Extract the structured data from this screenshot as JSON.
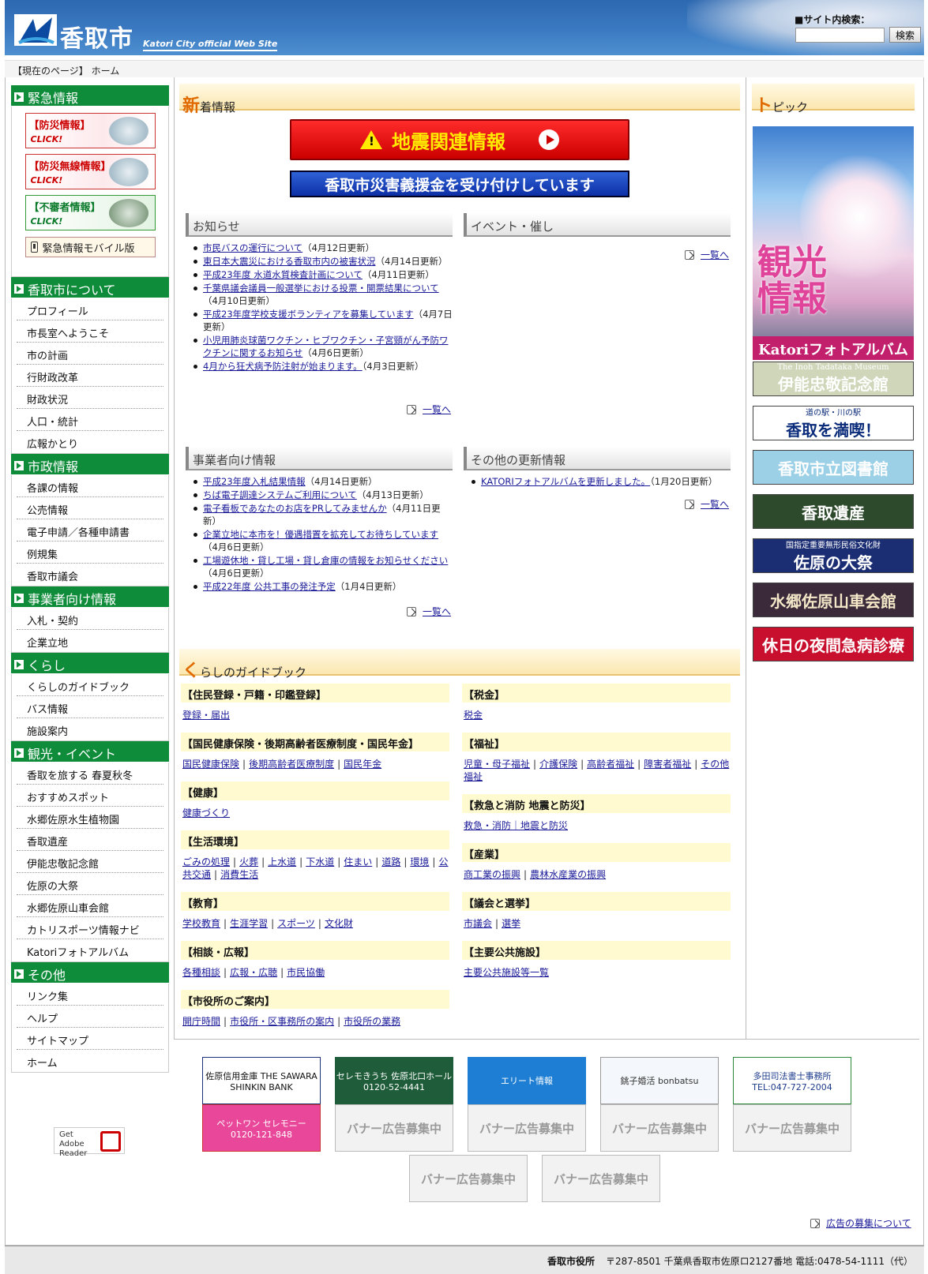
{
  "header": {
    "title": "香取市",
    "subtitle": "Katori City official Web Site",
    "search_label": "■サイト内検索：",
    "search_value": "",
    "search_button": "検索"
  },
  "breadcrumb": {
    "label": "【現在のページ】",
    "current": "ホーム"
  },
  "left_nav": {
    "emergency": {
      "title": "緊急情報",
      "banners": [
        {
          "label": "【防災情報】",
          "click": "CLICK!"
        },
        {
          "label": "【防災無線情報】",
          "click": "CLICK!"
        },
        {
          "label": "【不審者情報】",
          "click": "CLICK!"
        }
      ],
      "mobile": "緊急情報モバイル版"
    },
    "sections": [
      {
        "title": "香取市について",
        "items": [
          "プロフィール",
          "市長室へようこそ",
          "市の計画",
          "行財政改革",
          "財政状況",
          "人口・統計",
          "広報かとり"
        ]
      },
      {
        "title": "市政情報",
        "items": [
          "各課の情報",
          "公売情報",
          "電子申請／各種申請書",
          "例規集",
          "香取市議会"
        ]
      },
      {
        "title": "事業者向け情報",
        "items": [
          "入札・契約",
          "企業立地"
        ]
      },
      {
        "title": "くらし",
        "items": [
          "くらしのガイドブック",
          "バス情報",
          "施設案内"
        ]
      },
      {
        "title": "観光・イベント",
        "items": [
          "香取を旅する 春夏秋冬",
          "おすすめスポット",
          "水郷佐原水生植物園",
          "香取遺産",
          "伊能忠敬記念館",
          "佐原の大祭",
          "水郷佐原山車会館",
          "カトリスポーツ情報ナビ",
          "Katoriフォトアルバム"
        ]
      },
      {
        "title": "その他",
        "items": [
          "リンク集",
          "ヘルプ",
          "サイトマップ",
          "ホーム"
        ]
      }
    ],
    "adobe": "Get Adobe Reader"
  },
  "main": {
    "whatsnew_title_big": "新",
    "whatsnew_title": "着情報",
    "quake_button": "地震関連情報",
    "donation_button": "香取市災害義援金を受け付けしています",
    "more_label": "一覧へ",
    "notices": {
      "title": "お知らせ",
      "items": [
        {
          "text": "市民バスの運行について",
          "date": "（4月12日更新）"
        },
        {
          "text": "東日本大震災における香取市内の被害状況",
          "date": "（4月14日更新）"
        },
        {
          "text": "平成23年度 水道水質検査計画について",
          "date": "（4月11日更新）"
        },
        {
          "text": "千葉県議会議員一般選挙における投票・開票結果について",
          "date": "（4月10日更新）"
        },
        {
          "text": "平成23年度学校支援ボランティアを募集しています",
          "date": "（4月7日更新）"
        },
        {
          "text": "小児用肺炎球菌ワクチン・ヒブワクチン・子宮頸がん予防ワクチンに関するお知らせ",
          "date": "（4月6日更新）"
        },
        {
          "text": "4月から狂犬病予防注射が始まります。",
          "date": "（4月3日更新）"
        }
      ]
    },
    "events": {
      "title": "イベント・催し",
      "items": []
    },
    "business": {
      "title": "事業者向け情報",
      "items": [
        {
          "text": "平成23年度入札結果情報",
          "date": "（4月14日更新）"
        },
        {
          "text": "ちば電子調達システムご利用について",
          "date": "（4月13日更新）"
        },
        {
          "text": "電子看板であなたのお店をPRしてみませんか",
          "date": "（4月11日更新）"
        },
        {
          "text": "企業立地に本市を！優遇措置を拡充してお待ちしています",
          "date": "（4月6日更新）"
        },
        {
          "text": "工場遊休地・貸し工場・貸し倉庫の情報をお知らせください",
          "date": "（4月6日更新）"
        },
        {
          "text": "平成22年度 公共工事の発注予定",
          "date": "（1月4日更新）"
        }
      ]
    },
    "others": {
      "title": "その他の更新情報",
      "items": [
        {
          "text": "KATORIフォトアルバムを更新しました。",
          "date": "（1月20日更新）"
        }
      ]
    },
    "guide": {
      "title_big": "く",
      "title": "らしのガイドブック",
      "left": [
        {
          "head": "【住民登録・戸籍・印鑑登録】",
          "links": [
            "登録・届出"
          ]
        },
        {
          "head": "【国民健康保険・後期高齢者医療制度・国民年金】",
          "links": [
            "国民健康保険",
            "後期高齢者医療制度",
            "国民年金"
          ]
        },
        {
          "head": "【健康】",
          "links": [
            "健康づくり"
          ]
        },
        {
          "head": "【生活環境】",
          "links": [
            "ごみの処理",
            "火葬",
            "上水道",
            "下水道",
            "住まい",
            "道路",
            "環境",
            "公共交通",
            "消費生活"
          ]
        },
        {
          "head": "【教育】",
          "links": [
            "学校教育",
            "生涯学習",
            "スポーツ",
            "文化財"
          ]
        },
        {
          "head": "【相談・広報】",
          "links": [
            "各種相談",
            "広報・広聴",
            "市民協働"
          ]
        },
        {
          "head": "【市役所のご案内】",
          "links": [
            "開庁時間",
            "市役所・区事務所の案内",
            "市役所の業務"
          ]
        }
      ],
      "right": [
        {
          "head": "【税金】",
          "links": [
            "税金"
          ]
        },
        {
          "head": "【福祉】",
          "links": [
            "児童・母子福祉",
            "介護保険",
            "高齢者福祉",
            "障害者福祉",
            "その他福祉"
          ]
        },
        {
          "head": "【救急と消防 地震と防災】",
          "links": [
            "救急・消防｜地震と防災"
          ]
        },
        {
          "head": "【産業】",
          "links": [
            "商工業の振興",
            "農林水産業の振興"
          ]
        },
        {
          "head": "【議会と選挙】",
          "links": [
            "市議会",
            "選挙"
          ]
        },
        {
          "head": "【主要公共施設】",
          "links": [
            "主要公共施設等一覧"
          ]
        }
      ]
    }
  },
  "right": {
    "topics_big": "ト",
    "topics_title": "ピック",
    "kanko_text": "観光情報",
    "kanko_bar": "Katoriフォトアルバム",
    "banners": [
      {
        "text": "伊能忠敬記念館",
        "sub": "The Inoh Tadataka Museum",
        "bg": "#cfd6b9",
        "fg": "#fff"
      },
      {
        "text": "香取を満喫！",
        "sub": "道の駅・川の駅",
        "bg": "#fff",
        "fg": "#0b2c7a"
      },
      {
        "text": "香取市立図書館",
        "sub": "",
        "bg": "#9bd0e6",
        "fg": "#fff"
      },
      {
        "text": "香取遺産",
        "sub": "",
        "bg": "#2e4a2c",
        "fg": "#fff"
      },
      {
        "text": "佐原の大祭",
        "sub": "国指定重要無形民俗文化財",
        "bg": "#1c2e73",
        "fg": "#fff"
      },
      {
        "text": "水郷佐原山車会館",
        "sub": "",
        "bg": "#3a2a3a",
        "fg": "#f4e7c8"
      },
      {
        "text": "休日の夜間急病診療",
        "sub": "",
        "bg": "#c8102e",
        "fg": "#fff"
      }
    ]
  },
  "ads": {
    "items": [
      "佐原信用金庫 THE SAWARA SHINKIN BANK",
      "セレモきうち 佐原北口ホール 0120-52-4441",
      "エリート情報",
      "銚子婚活 bonbatsu",
      "多田司法書士事務所 TEL:047-727-2004",
      "ペットワン セレモニー 0120-121-848"
    ],
    "empty": "バナー広告募集中",
    "recruit_link": "広告の募集について"
  },
  "footer": {
    "org": "香取市役所",
    "address": "〒287-8501 千葉県香取市佐原ロ2127番地 電話:0478-54-1111（代）"
  }
}
